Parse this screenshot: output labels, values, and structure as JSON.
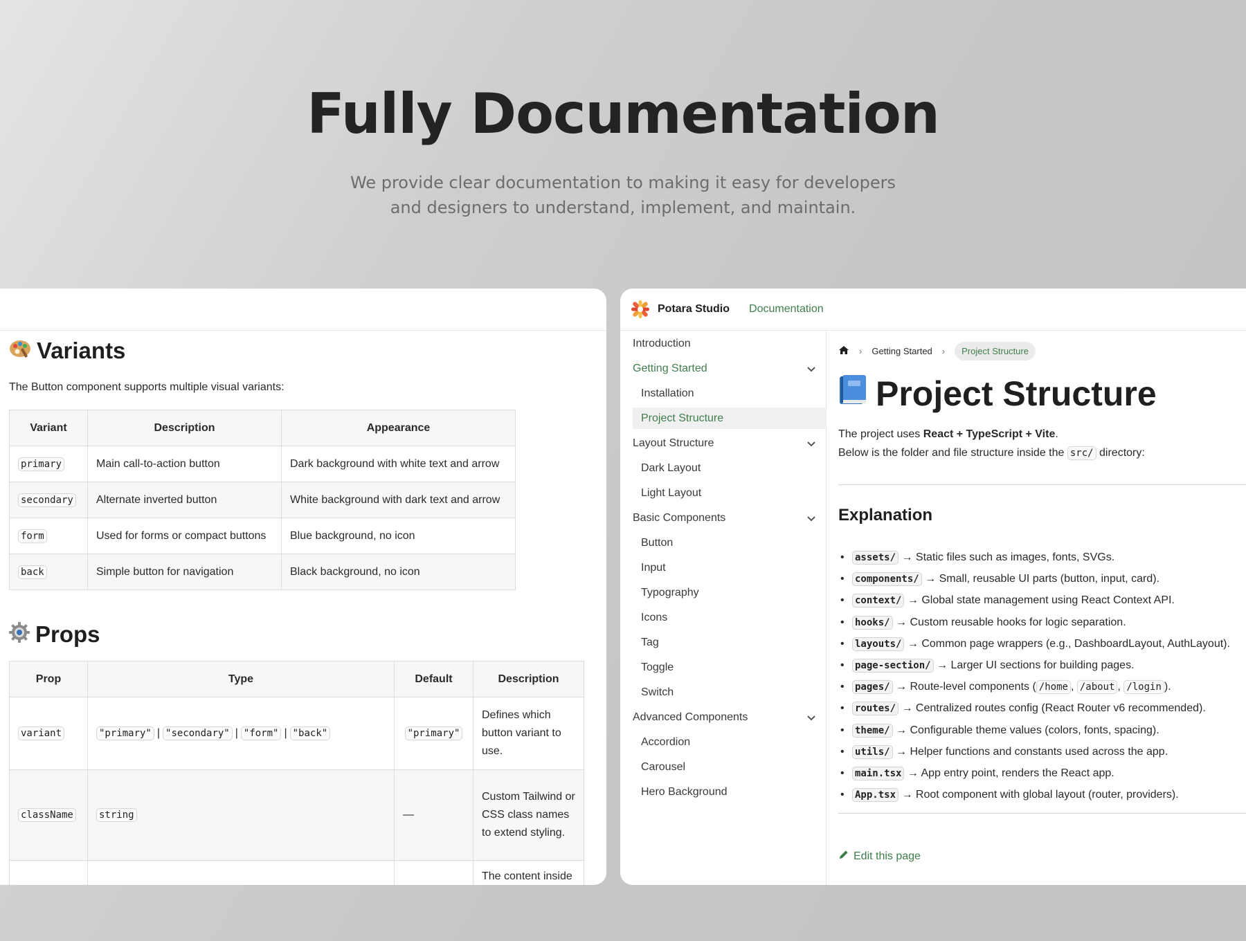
{
  "hero": {
    "title": "Fully Documentation",
    "subtitle_line1": "We provide clear documentation to making it easy for developers",
    "subtitle_line2": "and designers to understand, implement, and maintain."
  },
  "left_panel": {
    "variants": {
      "heading": "Variants",
      "icon": "palette-icon",
      "intro": "The Button component supports multiple visual variants:",
      "columns": [
        "Variant",
        "Description",
        "Appearance"
      ],
      "rows": [
        {
          "variant": "primary",
          "description": "Main call-to-action button",
          "appearance": "Dark background with white text and arrow"
        },
        {
          "variant": "secondary",
          "description": "Alternate inverted button",
          "appearance": "White background with dark text and arrow"
        },
        {
          "variant": "form",
          "description": "Used for forms or compact buttons",
          "appearance": "Blue background, no icon"
        },
        {
          "variant": "back",
          "description": "Simple button for navigation",
          "appearance": "Black background, no icon"
        }
      ]
    },
    "props": {
      "heading": "Props",
      "icon": "gear-icon",
      "columns": [
        "Prop",
        "Type",
        "Default",
        "Description"
      ],
      "rows": [
        {
          "prop": "variant",
          "type": [
            "\"primary\"",
            "\"secondary\"",
            "\"form\"",
            "\"back\""
          ],
          "type_sep": "|",
          "default": "\"primary\"",
          "description": "Defines which button variant to use."
        },
        {
          "prop": "className",
          "type_single": "string",
          "default_text": "—",
          "description": "Custom Tailwind or CSS class names to extend styling."
        },
        {
          "description": "The content inside"
        }
      ]
    }
  },
  "right_panel": {
    "brand": "Potara Studio",
    "nav_link": "Documentation",
    "accent_color": "#3f7d4a",
    "sidebar": {
      "items": [
        {
          "label": "Introduction"
        },
        {
          "label": "Getting Started"
        },
        {
          "label": "Installation"
        },
        {
          "label": "Project Structure"
        },
        {
          "label": "Layout Structure"
        },
        {
          "label": "Dark Layout"
        },
        {
          "label": "Light Layout"
        },
        {
          "label": "Basic Components"
        },
        {
          "label": "Button"
        },
        {
          "label": "Input"
        },
        {
          "label": "Typography"
        },
        {
          "label": "Icons"
        },
        {
          "label": "Tag"
        },
        {
          "label": "Toggle"
        },
        {
          "label": "Switch"
        },
        {
          "label": "Advanced Components"
        },
        {
          "label": "Accordion"
        },
        {
          "label": "Carousel"
        },
        {
          "label": "Hero Background"
        }
      ]
    },
    "breadcrumb": {
      "home_icon": "home-icon",
      "parent": "Getting Started",
      "current": "Project Structure"
    },
    "page": {
      "title": "Project Structure",
      "title_icon": "book-icon",
      "intro_prefix": "The project uses ",
      "intro_bold": "React + TypeScript + Vite",
      "intro_suffix": ".",
      "dir_prefix": "Below is the folder and file structure inside the ",
      "dir_code": "src/",
      "dir_suffix": " directory:",
      "explanation_heading": "Explanation",
      "explanations": [
        {
          "key": "assets/",
          "text": "→ Static files such as images, fonts, SVGs."
        },
        {
          "key": "components/",
          "text": "→ Small, reusable UI parts (button, input, card)."
        },
        {
          "key": "context/",
          "text": "→ Global state management using React Context API."
        },
        {
          "key": "hooks/",
          "text": "→ Custom reusable hooks for logic separation."
        },
        {
          "key": "layouts/",
          "text": "→ Common page wrappers (e.g., DashboardLayout, AuthLayout)."
        },
        {
          "key": "page-section/",
          "text": "→ Larger UI sections for building pages."
        },
        {
          "key": "pages/",
          "text": "→ Route-level components (",
          "routes": [
            "/home",
            "/about",
            "/login"
          ],
          "text_end": ")."
        },
        {
          "key": "routes/",
          "text": "→ Centralized routes config (React Router v6 recommended)."
        },
        {
          "key": "theme/",
          "text": "→ Configurable theme values (colors, fonts, spacing)."
        },
        {
          "key": "utils/",
          "text": "→ Helper functions and constants used across the app."
        },
        {
          "key": "main.tsx",
          "text": "→ App entry point, renders the React app."
        },
        {
          "key": "App.tsx",
          "text": "→ Root component with global layout (router, providers)."
        }
      ],
      "edit_label": "Edit this page"
    }
  }
}
